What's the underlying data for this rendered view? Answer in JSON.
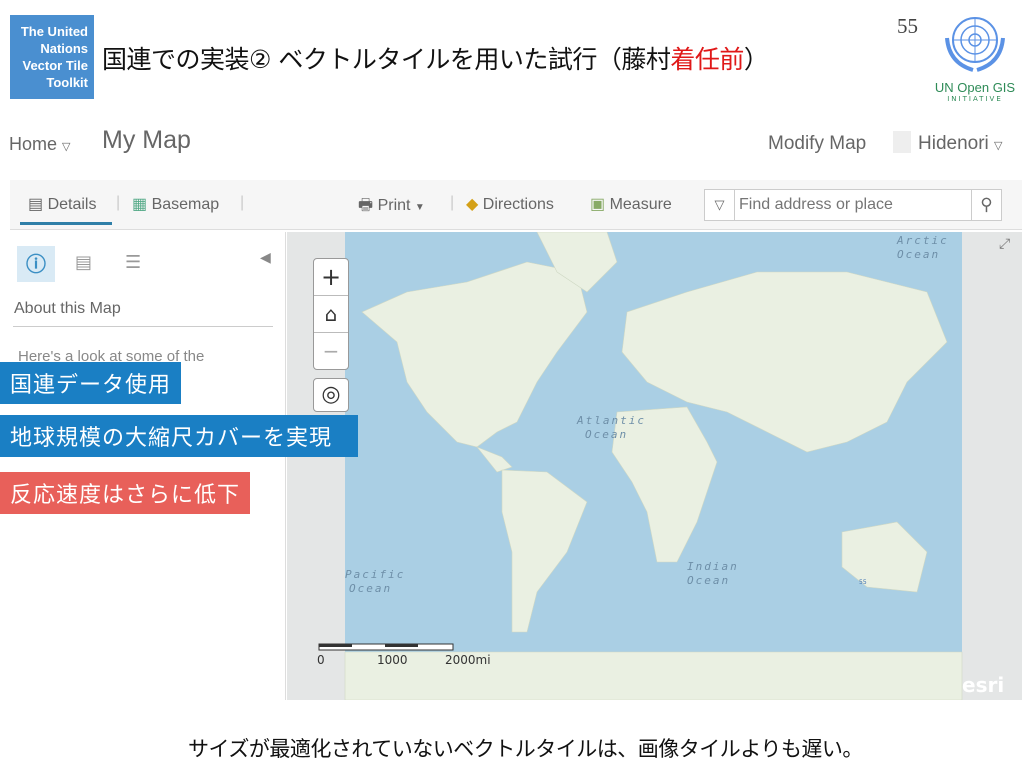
{
  "slide": {
    "logo_text": [
      "The United",
      "Nations",
      "Vector Tile",
      "Toolkit"
    ],
    "title_main": "国連での実装② ベクトルタイルを用いた試行（藤村",
    "title_red": "着任前",
    "title_end": "）",
    "page_number": "55",
    "un_logo": {
      "line1": "UN Open GIS",
      "line2": "INITIATIVE"
    },
    "caption": "サイズが最適化されていないベクトルタイルは、画像タイルよりも遅い。",
    "callouts": [
      {
        "text": "国連データ使用",
        "color": "#1a7fc4"
      },
      {
        "text": "地球規模の大縮尺カバーを実現",
        "color": "#1a7fc4"
      },
      {
        "text": "反応速度はさらに低下",
        "color": "#e8605a"
      }
    ]
  },
  "app": {
    "home": "Home",
    "map_title": "My Map",
    "modify": "Modify Map",
    "user": "Hidenori",
    "toolbar": {
      "details": "Details",
      "basemap": "Basemap",
      "print": "Print",
      "directions": "Directions",
      "measure": "Measure",
      "search_placeholder": "Find address or place"
    },
    "side": {
      "about": "About this Map",
      "desc": "Here's a look at some of the"
    },
    "map": {
      "arctic": [
        "Arctic",
        "Ocean"
      ],
      "atlantic": [
        "Atlantic",
        "Ocean"
      ],
      "pacific": [
        "Pacific",
        "Ocean"
      ],
      "indian": [
        "Indian",
        "Ocean"
      ],
      "scale": [
        "0",
        "1000",
        "2000mi"
      ],
      "attribution": "esri",
      "small_label": "55"
    },
    "colors": {
      "ocean": "#aacfe4",
      "land": "#eaf0e2",
      "accent": "#2f7fa8"
    }
  }
}
